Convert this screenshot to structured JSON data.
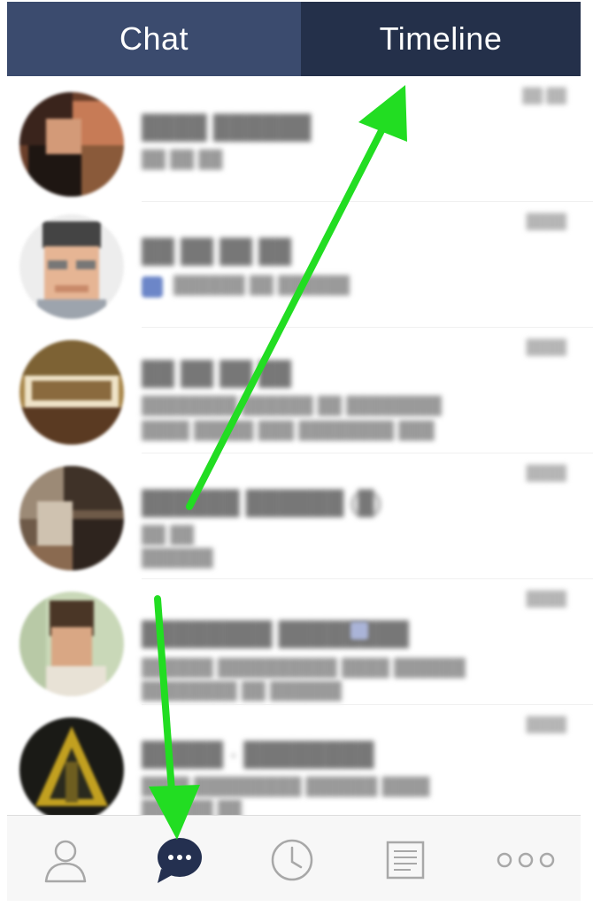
{
  "header": {
    "tabs": [
      {
        "label": "Chat",
        "active": true
      },
      {
        "label": "Timeline",
        "active": false
      }
    ],
    "colors": {
      "chat_tab": "#3b4b6e",
      "timeline_tab": "#24304a",
      "text": "#ffffff"
    }
  },
  "chat_list": {
    "rows": [
      {
        "name": "████ ██████",
        "line1": "██ ██ ██",
        "line2": "",
        "time": "██:██"
      },
      {
        "name": "██ ██ ██ ██",
        "line1": "██████ ██ ██████",
        "line2": "",
        "time": "████"
      },
      {
        "name": "██ ██ ██ ██",
        "line1": "████████ ██████ ██ ████████",
        "line2": "████ █████ ███ ████████ ███",
        "time": "████"
      },
      {
        "name": "██████ ██████ (█)",
        "line1": "██ ██",
        "line2": "██████",
        "time": "████"
      },
      {
        "name": "████████ ████████",
        "line1": "██████ ██████████ ████ ██████",
        "line2": "████████ ██ ██████",
        "time": "████"
      },
      {
        "name": "█████ · ████████",
        "line1": "████ █████████ ██████ ████",
        "line2": "██████ ██",
        "time": "████"
      }
    ]
  },
  "tabbar": {
    "items": [
      {
        "icon": "friends-icon"
      },
      {
        "icon": "chat-bubble-icon",
        "active": true
      },
      {
        "icon": "clock-icon"
      },
      {
        "icon": "news-icon"
      },
      {
        "icon": "more-icon"
      }
    ],
    "colors": {
      "active": "#243050",
      "inactive": "#a8a8a8"
    }
  },
  "annotations": {
    "arrow_color": "#22dd22"
  }
}
